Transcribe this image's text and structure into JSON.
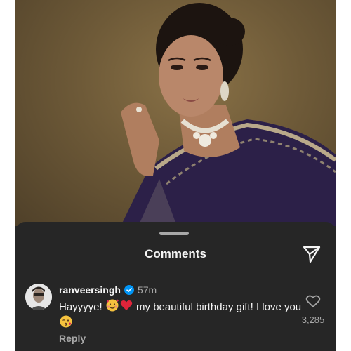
{
  "sheet": {
    "title": "Comments"
  },
  "comment": {
    "username": "ranveersingh",
    "time": "57m",
    "text_part1": "Hayyyye! ",
    "text_part2": " my beautiful birthday gift! I love you",
    "reply_label": "Reply",
    "like_count": "3,285"
  },
  "icons": {
    "share": "paper-plane-icon",
    "verified": "verified-badge-icon",
    "like": "heart-outline-icon",
    "emoji_1": "smiling-face-with-hearts-emoji",
    "emoji_2": "red-heart-emoji",
    "emoji_3": "face-blowing-kiss-emoji"
  },
  "colors": {
    "sheet_background": "#262626",
    "text_primary": "#f5f5f5",
    "text_secondary": "#a8a8a8",
    "verified_blue": "#0095f6",
    "photo_background": "#6e5a38"
  }
}
